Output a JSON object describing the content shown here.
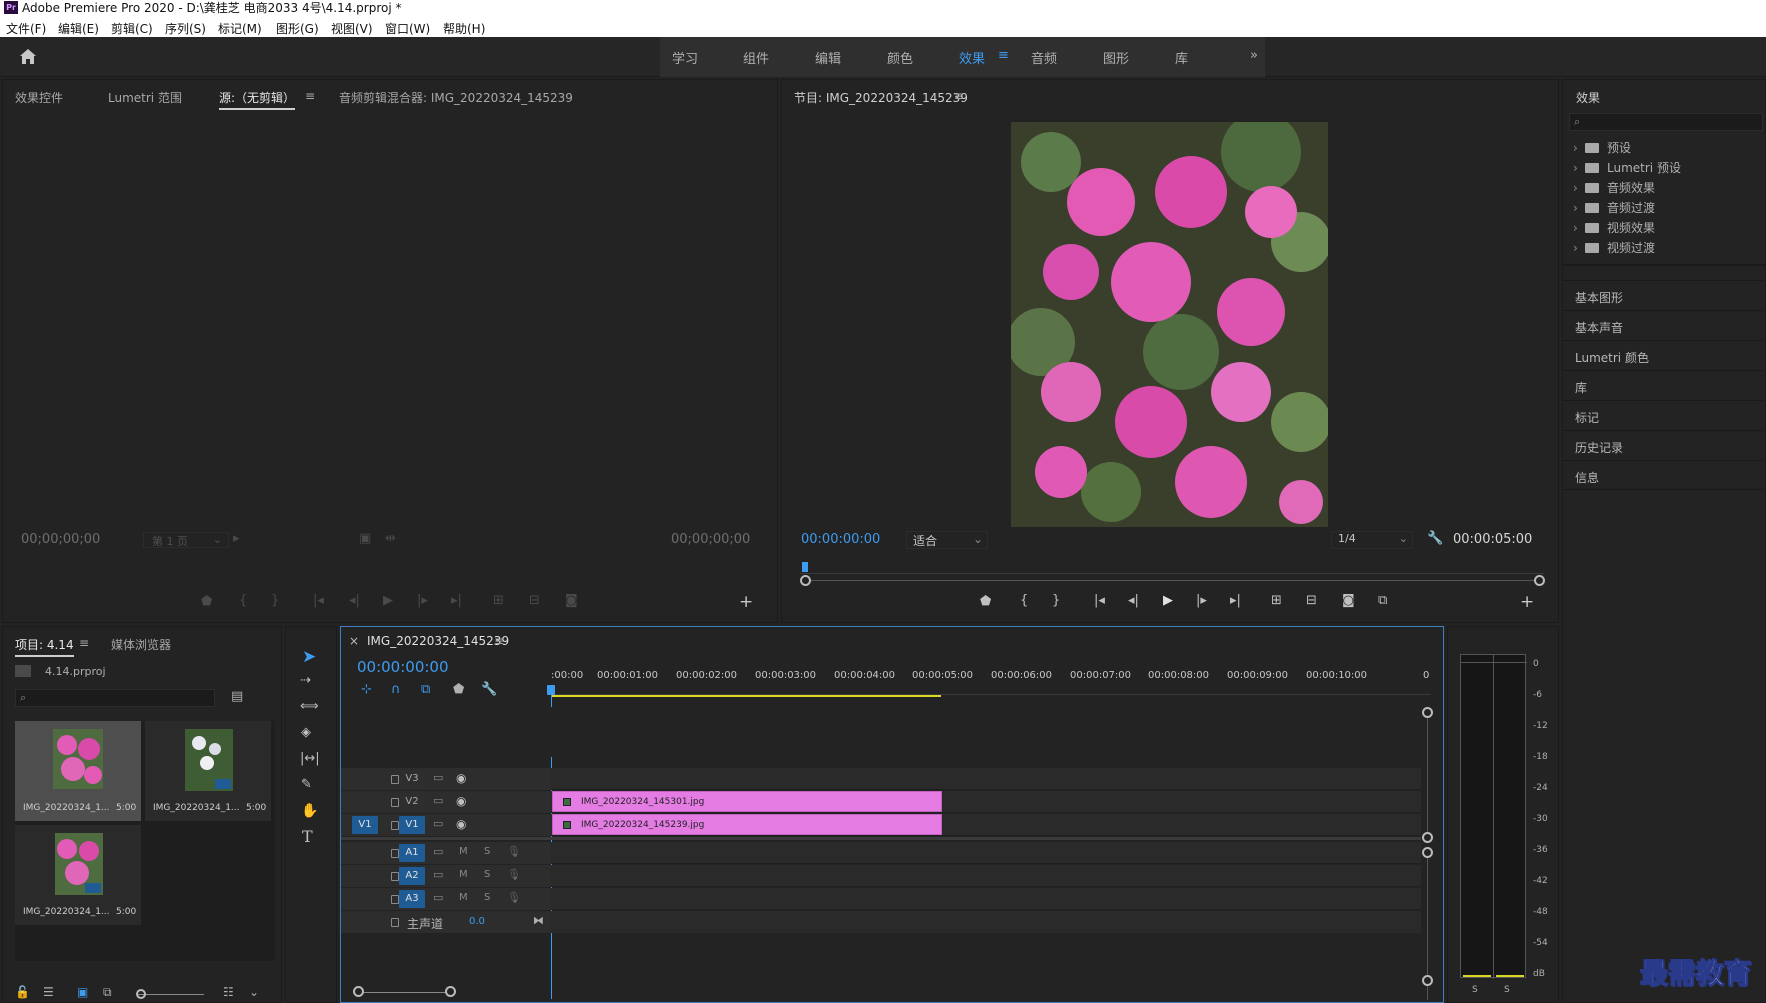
{
  "window": {
    "logo": "Pr",
    "title": "Adobe Premiere Pro 2020 - D:\\龚桂芝 电商2033 4号\\4.14.prproj *"
  },
  "menu": [
    "文件(F)",
    "编辑(E)",
    "剪辑(C)",
    "序列(S)",
    "标记(M)",
    "图形(G)",
    "视图(V)",
    "窗口(W)",
    "帮助(H)"
  ],
  "workspaces": [
    "学习",
    "组件",
    "编辑",
    "颜色",
    "效果",
    "音频",
    "图形",
    "库"
  ],
  "workspace_active": "效果",
  "workspace_more": "»",
  "source_panel": {
    "tabs": [
      "效果控件",
      "Lumetri 范围",
      "源:（无剪辑）",
      "音频剪辑混合器: IMG_20220324_145239"
    ],
    "timecode_in": "00;00;00;00",
    "page": "第 1 页",
    "timecode_out": "00;00;00;00"
  },
  "program_panel": {
    "title": "节目: IMG_20220324_145239",
    "timecode": "00:00:00:00",
    "fit": "适合",
    "resolution": "1/4",
    "duration": "00:00:05:00"
  },
  "effects_panel": {
    "title": "效果",
    "tree": [
      "预设",
      "Lumetri 预设",
      "音频效果",
      "音频过渡",
      "视频效果",
      "视频过渡"
    ],
    "panels": [
      "基本图形",
      "基本声音",
      "Lumetri 颜色",
      "库",
      "标记",
      "历史记录",
      "信息"
    ]
  },
  "project_panel": {
    "tabs": [
      "项目: 4.14",
      "媒体浏览器"
    ],
    "file": "4.14.prproj",
    "items": [
      {
        "name": "IMG_20220324_1...",
        "duration": "5:00"
      },
      {
        "name": "IMG_20220324_1...",
        "duration": "5:00"
      },
      {
        "name": "IMG_20220324_1...",
        "duration": "5:00"
      }
    ]
  },
  "timeline": {
    "tab": "IMG_20220324_145239",
    "close": "×",
    "timecode": "00:00:00:00",
    "ruler": [
      ":00:00",
      "00:00:01:00",
      "00:00:02:00",
      "00:00:03:00",
      "00:00:04:00",
      "00:00:05:00",
      "00:00:06:00",
      "00:00:07:00",
      "00:00:08:00",
      "00:00:09:00",
      "00:00:10:00",
      "0"
    ],
    "video_tracks": [
      "V3",
      "V2",
      "V1"
    ],
    "source_patch": "V1",
    "audio_tracks": [
      "A1",
      "A2",
      "A3"
    ],
    "audio_buttons": {
      "mute": "M",
      "solo": "S"
    },
    "master": {
      "label": "主声道",
      "value": "0.0"
    },
    "clips": [
      {
        "track": "V2",
        "name": "IMG_20220324_145301.jpg"
      },
      {
        "track": "V1",
        "name": "IMG_20220324_145239.jpg"
      }
    ]
  },
  "audio_meter": {
    "scale": [
      "0",
      "-6",
      "-12",
      "-18",
      "-24",
      "-30",
      "-36",
      "-42",
      "-48",
      "-54",
      "dB"
    ],
    "solo": [
      "S",
      "S"
    ]
  },
  "watermark": "最需教育",
  "colors": {
    "accent": "#3d9cf0",
    "clip": "#e47ce4",
    "panel": "#232323"
  }
}
